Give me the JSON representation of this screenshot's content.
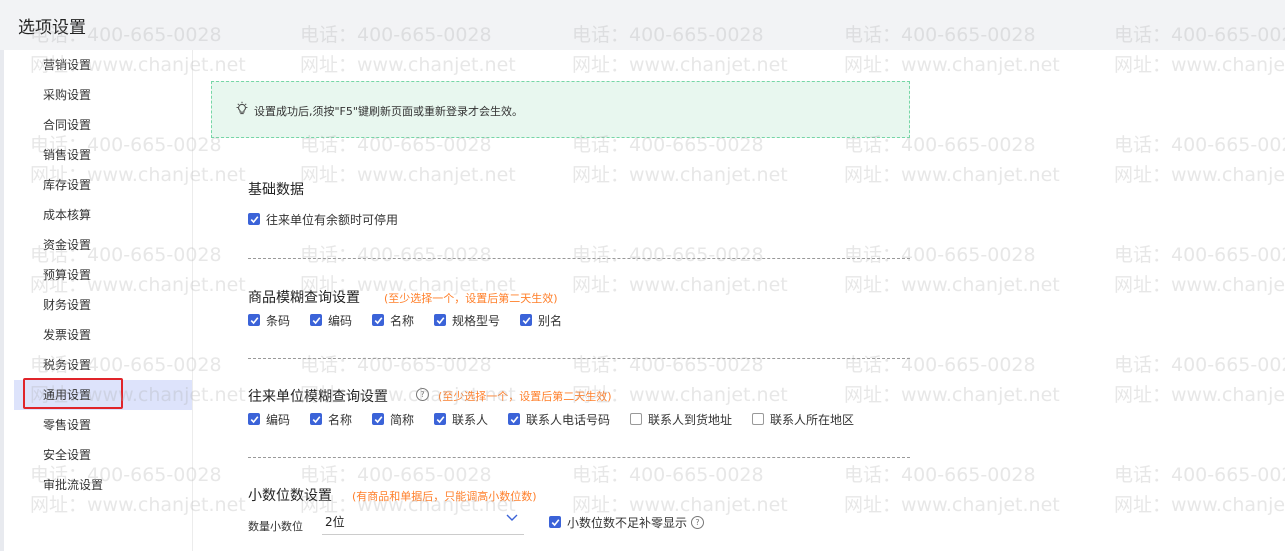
{
  "window": {
    "title": "选项设置"
  },
  "sidebar": {
    "items": [
      {
        "label": "营销设置"
      },
      {
        "label": "采购设置"
      },
      {
        "label": "合同设置"
      },
      {
        "label": "销售设置"
      },
      {
        "label": "库存设置"
      },
      {
        "label": "成本核算"
      },
      {
        "label": "资金设置"
      },
      {
        "label": "预算设置"
      },
      {
        "label": "财务设置"
      },
      {
        "label": "发票设置"
      },
      {
        "label": "税务设置"
      },
      {
        "label": "通用设置"
      },
      {
        "label": "零售设置"
      },
      {
        "label": "安全设置"
      },
      {
        "label": "审批流设置"
      }
    ],
    "active": "通用设置"
  },
  "notice": {
    "icon": "lightbulb-icon",
    "text": "设置成功后,须按\"F5\"键刷新页面或重新登录才会生效。"
  },
  "sections": {
    "basic": {
      "title": "基础数据",
      "options": [
        {
          "label": "往来单位有余额时可停用",
          "checked": true
        }
      ]
    },
    "product_search": {
      "title": "商品模糊查询设置",
      "hint": "(至少选择一个，设置后第二天生效)",
      "options": [
        {
          "label": "条码",
          "checked": true
        },
        {
          "label": "编码",
          "checked": true
        },
        {
          "label": "名称",
          "checked": true
        },
        {
          "label": "规格型号",
          "checked": true
        },
        {
          "label": "别名",
          "checked": true
        }
      ]
    },
    "partner_search": {
      "title": "往来单位模糊查询设置",
      "hint": "(至少选择一个，设置后第二天生效)",
      "options": [
        {
          "label": "编码",
          "checked": true
        },
        {
          "label": "名称",
          "checked": true
        },
        {
          "label": "简称",
          "checked": true
        },
        {
          "label": "联系人",
          "checked": true
        },
        {
          "label": "联系人电话号码",
          "checked": true
        },
        {
          "label": "联系人到货地址",
          "checked": false
        },
        {
          "label": "联系人所在地区",
          "checked": false
        }
      ]
    },
    "decimal": {
      "title": "小数位数设置",
      "hint": "(有商品和单据后，只能调高小数位数)",
      "quantity_label": "数量小数位",
      "quantity_value": "2位",
      "options": [
        {
          "label": "小数位数不足补零显示",
          "checked": true
        }
      ]
    }
  },
  "watermark": {
    "line1": "电话：400-665-0028",
    "line2": "网址：www.chanjet.net"
  },
  "colors": {
    "accent": "#3b63d8",
    "hint": "#ff7f2a",
    "highlight": "#e0242a",
    "notice_bg": "#e8f7ef"
  }
}
